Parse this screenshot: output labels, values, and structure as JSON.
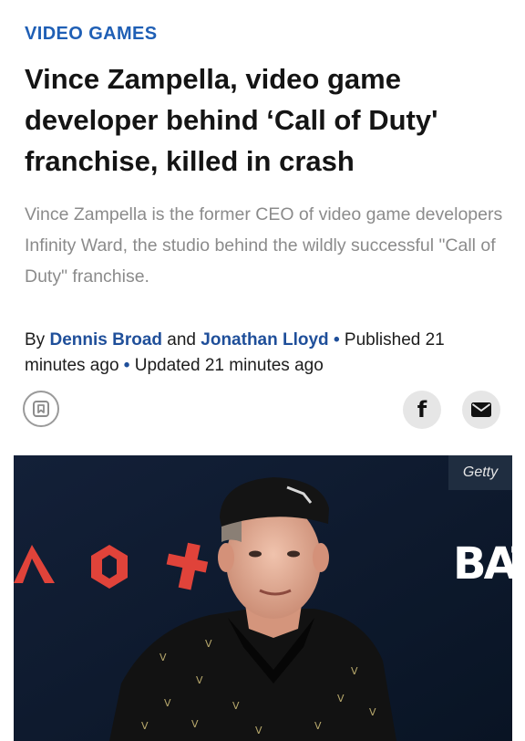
{
  "article": {
    "category": "VIDEO GAMES",
    "headline": "Vince Zampella, video game developer behind ‘Call of Duty' franchise, killed in crash",
    "dek": "Vince Zampella is the former CEO of video game developers Infinity Ward, the studio behind the wildly successful \"Call of Duty\" franchise.",
    "byline": {
      "prefix": "By",
      "author1": "Dennis Broad",
      "conjunction": "and",
      "author2": "Jonathan Lloyd",
      "separator": "•",
      "published": "Published 21 minutes ago",
      "updated": "Updated 21 minutes ago"
    }
  },
  "actions": {
    "save_icon": "bookmark-icon",
    "facebook_label": "f",
    "mail_icon": "mail-icon"
  },
  "photo": {
    "credit": "Getty",
    "backdrop_text": "BAT",
    "accent_color": "#e0433a"
  }
}
